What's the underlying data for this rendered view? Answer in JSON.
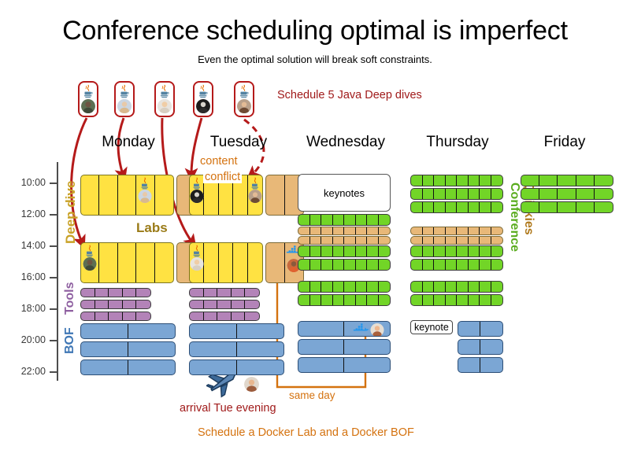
{
  "header": {
    "title": "Conference scheduling optimal is imperfect",
    "subtitle": "Even the optimal solution will break soft constraints."
  },
  "annotations": {
    "schedule_java": "Schedule 5 Java Deep dives",
    "content": "content",
    "conflict": "conflict",
    "labs": "Labs",
    "same_day": "same day",
    "arrival": "arrival Tue evening",
    "schedule_docker": "Schedule a Docker Lab and a Docker BOF"
  },
  "axis": {
    "ticks": [
      "10:00",
      "12:00",
      "14:00",
      "16:00",
      "18:00",
      "20:00",
      "22:00"
    ]
  },
  "category_labels": [
    {
      "text": "Deep dive",
      "color": "#c9a227"
    },
    {
      "text": "Tools",
      "color": "#8e5fa0"
    },
    {
      "text": "BOF",
      "color": "#3f77b5"
    },
    {
      "text": "Quickies",
      "color": "#b07a1e"
    },
    {
      "text": "Conference",
      "color": "#5aac1e"
    }
  ],
  "days": [
    {
      "id": "monday",
      "label": "Monday"
    },
    {
      "id": "tuesday",
      "label": "Tuesday"
    },
    {
      "id": "wednesday",
      "label": "Wednesday"
    },
    {
      "id": "thursday",
      "label": "Thursday"
    },
    {
      "id": "friday",
      "label": "Friday"
    }
  ],
  "speaker_cards": [
    {
      "id": "card-1",
      "topic_icon": "java-icon",
      "avatar": "avatar-1",
      "arrow": "solid"
    },
    {
      "id": "card-2",
      "topic_icon": "java-icon",
      "avatar": "avatar-2",
      "arrow": "solid"
    },
    {
      "id": "card-3",
      "topic_icon": "java-icon",
      "avatar": "avatar-3",
      "arrow": "solid"
    },
    {
      "id": "card-4",
      "topic_icon": "java-icon",
      "avatar": "avatar-4",
      "arrow": "solid"
    },
    {
      "id": "card-5",
      "topic_icon": "java-icon",
      "avatar": "avatar-5",
      "arrow": "dashed"
    }
  ],
  "boxes": {
    "keynotes": "keynotes",
    "keynote": "keynote"
  },
  "colors": {
    "deep_dive": "#ffe242",
    "lab": "#e8b878",
    "conference": "#72d527",
    "tools": "#b383b8",
    "bof": "#7ba6d4",
    "arrow_red": "#b51a1a",
    "annotation_orange": "#d4720f",
    "annotation_red": "#a01a1a"
  },
  "grid": {
    "monday": {
      "deep_dive_rows": [
        {
          "yellow": 5,
          "tan": 2,
          "markers": [
            {
              "cell": 4,
              "icon": "java-icon",
              "avatar": "avatar-2"
            }
          ]
        },
        {
          "yellow": 5,
          "tan": 2,
          "markers": [
            {
              "cell": 1,
              "icon": "java-icon",
              "avatar": "avatar-1"
            }
          ]
        }
      ],
      "tools_rows": 3,
      "bof_rows": 3
    },
    "tuesday": {
      "deep_dive_rows": [
        {
          "yellow": 5,
          "tan": 2,
          "markers": [
            {
              "cell": 1,
              "icon": "java-icon",
              "avatar": "avatar-4"
            },
            {
              "cell": 5,
              "icon": "java-icon",
              "avatar": "avatar-5"
            }
          ]
        },
        {
          "yellow": 5,
          "tan": 2,
          "markers": [
            {
              "cell": 1,
              "icon": "java-icon",
              "avatar": "avatar-3"
            },
            {
              "cell": 7,
              "icon": "docker-icon",
              "avatar": "avatar-6"
            }
          ]
        }
      ],
      "tools_rows": 3,
      "bof_rows": 3
    },
    "wednesday": {
      "keynote_box": "keynotes",
      "conference_rows": [
        {
          "type": "green",
          "cells": 8
        },
        {
          "type": "tan",
          "cells": 8
        },
        {
          "type": "tan",
          "cells": 8
        },
        {
          "type": "green",
          "cells": 8
        },
        {
          "type": "green",
          "cells": 8
        }
      ],
      "quickies_rows": [
        {
          "type": "green",
          "cells": 8
        },
        {
          "type": "green",
          "cells": 8
        }
      ],
      "bof_rows": 3,
      "bof_marker": {
        "row": 1,
        "icon": "docker-icon",
        "avatar": "avatar-7"
      }
    },
    "thursday": {
      "conference_rows": [
        {
          "type": "green",
          "cells": 8
        },
        {
          "type": "green",
          "cells": 8
        },
        {
          "type": "green",
          "cells": 8
        },
        {
          "type": "tan",
          "cells": 8
        },
        {
          "type": "tan",
          "cells": 8
        },
        {
          "type": "green",
          "cells": 8
        },
        {
          "type": "green",
          "cells": 8
        }
      ],
      "quickies_rows": [
        {
          "type": "green",
          "cells": 8
        },
        {
          "type": "green",
          "cells": 8
        }
      ],
      "bof_rows": 3,
      "keynote_badge": "keynote"
    },
    "friday": {
      "conference_rows": [
        {
          "type": "green",
          "cells": 5
        },
        {
          "type": "green",
          "cells": 5
        },
        {
          "type": "green",
          "cells": 5
        }
      ]
    }
  },
  "icons": {
    "java": "java-icon",
    "docker": "docker-icon",
    "airplane": "airplane-icon"
  }
}
